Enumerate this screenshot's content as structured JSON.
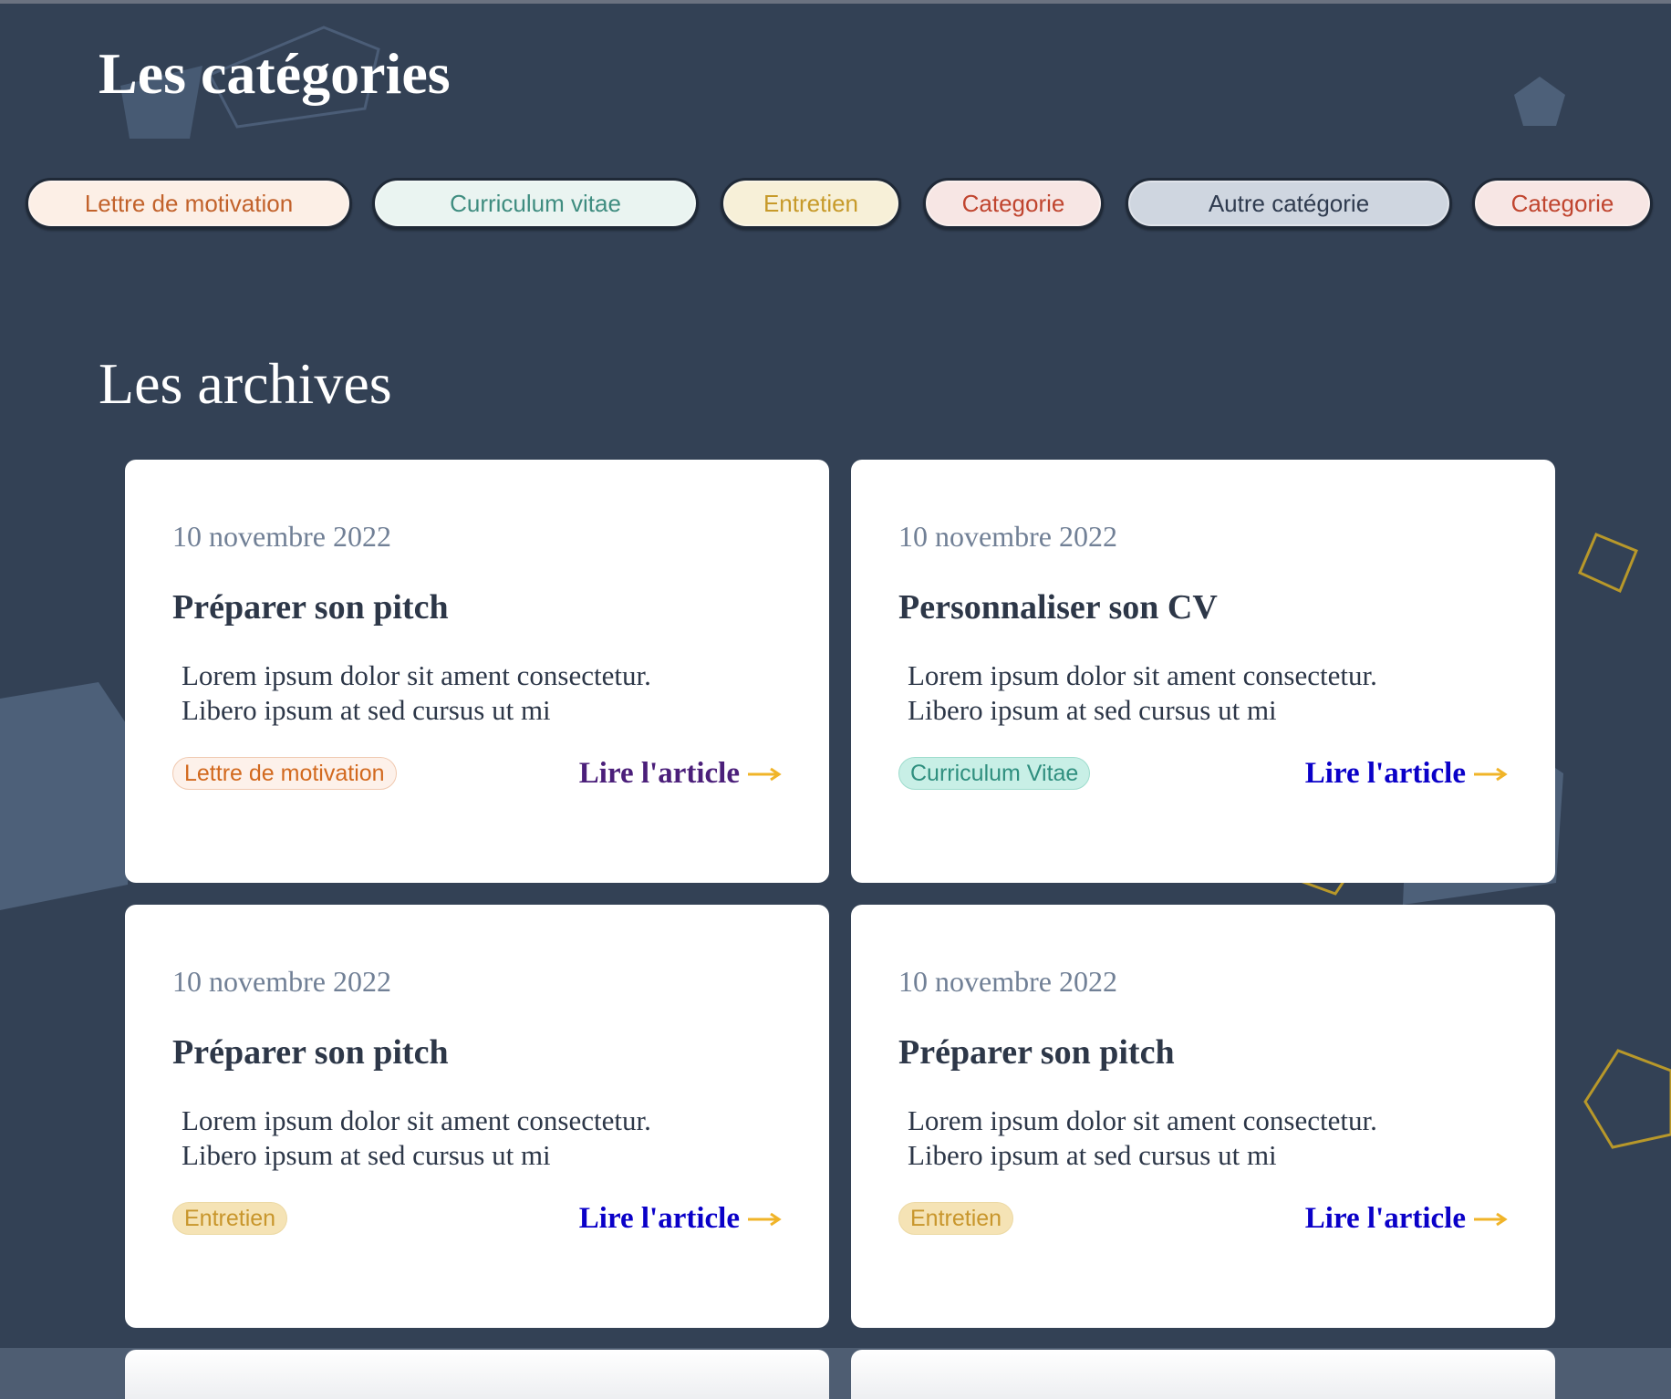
{
  "categories_section": {
    "title": "Les catégories",
    "pills": [
      {
        "label": "Lettre de motivation",
        "bg": "#fcefe6",
        "color": "#c2622b"
      },
      {
        "label": "Curriculum vitae",
        "bg": "#eaf4f1",
        "color": "#3f8d80"
      },
      {
        "label": "Entretien",
        "bg": "#f7f0d8",
        "color": "#c79a2a"
      },
      {
        "label": "Categorie",
        "bg": "#f7e6e4",
        "color": "#c0452f"
      },
      {
        "label": "Autre catégorie",
        "bg": "#cfd6e0",
        "color": "#2f3b4f"
      },
      {
        "label": "Categorie",
        "bg": "#f7e6e4",
        "color": "#c0452f"
      }
    ]
  },
  "archives_section": {
    "title": "Les archives",
    "cards": [
      {
        "date": "10 novembre 2022",
        "title": "Préparer son pitch",
        "excerpt_line1": "Lorem ipsum dolor sit ament consectetur.",
        "excerpt_line2": "Libero ipsum at sed cursus ut mi",
        "tag": "Lettre de motivation",
        "tag_bg": "#fdf1ea",
        "tag_color": "#d2691e",
        "tag_border": "#f0c9b0",
        "link": "Lire l'article",
        "link_color": "#4b1f7a"
      },
      {
        "date": "10 novembre 2022",
        "title": "Personnaliser son CV",
        "excerpt_line1": "Lorem ipsum dolor sit ament consectetur.",
        "excerpt_line2": "Libero ipsum at sed cursus ut mi",
        "tag": "Curriculum Vitae",
        "tag_bg": "#c8efe6",
        "tag_color": "#2f8f7f",
        "tag_border": "#9edccd",
        "link": "Lire l'article",
        "link_color": "#0a00c8"
      },
      {
        "date": "10 novembre 2022",
        "title": "Préparer son pitch",
        "excerpt_line1": "Lorem ipsum dolor sit ament consectetur.",
        "excerpt_line2": "Libero ipsum at sed cursus ut mi",
        "tag": "Entretien",
        "tag_bg": "#f5e3b5",
        "tag_color": "#c8962c",
        "tag_border": "#ecd9a4",
        "link": "Lire l'article",
        "link_color": "#0a00c8"
      },
      {
        "date": "10 novembre 2022",
        "title": "Préparer son pitch",
        "excerpt_line1": "Lorem ipsum dolor sit ament consectetur.",
        "excerpt_line2": "Libero ipsum at sed cursus ut mi",
        "tag": "Entretien",
        "tag_bg": "#f5e3b5",
        "tag_color": "#c8962c",
        "tag_border": "#ecd9a4",
        "link": "Lire l'article",
        "link_color": "#0a00c8"
      }
    ]
  },
  "colors": {
    "background": "#334155",
    "arrow": "#f0b429",
    "deco_outline": "#b8982a"
  },
  "icons": {
    "read_more": "arrow-right-icon",
    "decorations": [
      "pentagon-outline",
      "pentagon-filled",
      "diamond-outline"
    ]
  }
}
